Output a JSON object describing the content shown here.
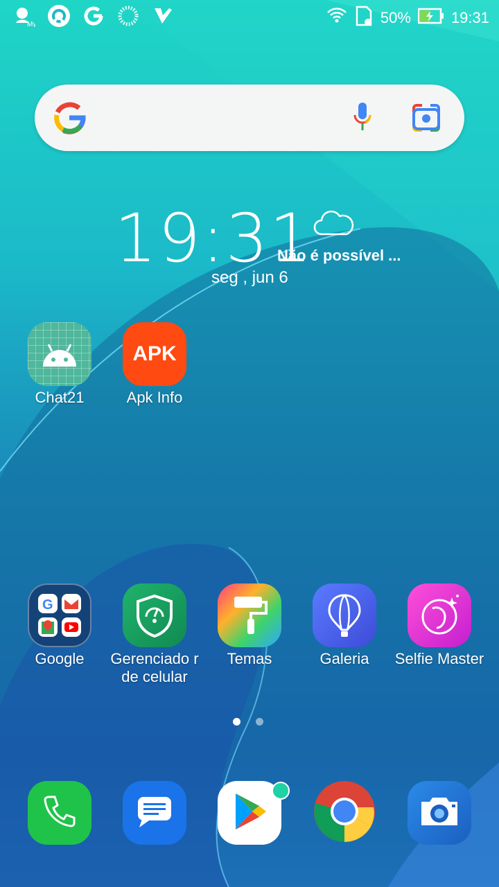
{
  "status_bar": {
    "battery": "50%",
    "time": "19:31",
    "left_icons": [
      "my-asus-icon",
      "round-app-icon",
      "google-g-icon",
      "spinner-icon",
      "check-app-icon"
    ],
    "right_icons": [
      "wifi-icon",
      "sd-card-icon",
      "battery-charging-icon"
    ]
  },
  "search": {
    "icons": [
      "google-logo-icon",
      "microphone-icon",
      "google-lens-icon"
    ]
  },
  "widget": {
    "time": "19:31",
    "date": "seg , jun 6",
    "weather": "Não é possível ...",
    "weather_icon": "cloud-icon"
  },
  "home_apps": [
    {
      "label": "Chat21",
      "icon": "android-icon"
    },
    {
      "label": "Apk Info",
      "icon": "apk-icon",
      "icon_text": "APK"
    }
  ],
  "row_apps": [
    {
      "label": "Google",
      "icon": "google-folder-icon"
    },
    {
      "label": "Gerenciado r de celular",
      "icon": "shield-icon"
    },
    {
      "label": "Temas",
      "icon": "paint-roller-icon"
    },
    {
      "label": "Galeria",
      "icon": "balloon-icon"
    },
    {
      "label": "Selfie Master",
      "icon": "selfie-face-icon"
    }
  ],
  "page_indicator": {
    "pages": 2,
    "current": 1
  },
  "dock": [
    "phone-icon",
    "messages-icon",
    "play-store-icon",
    "chrome-icon",
    "camera-icon"
  ],
  "colors": {
    "apk_orange": "#ff4a12",
    "phone_green": "#1fc34a",
    "messages_blue": "#1a73e8"
  }
}
